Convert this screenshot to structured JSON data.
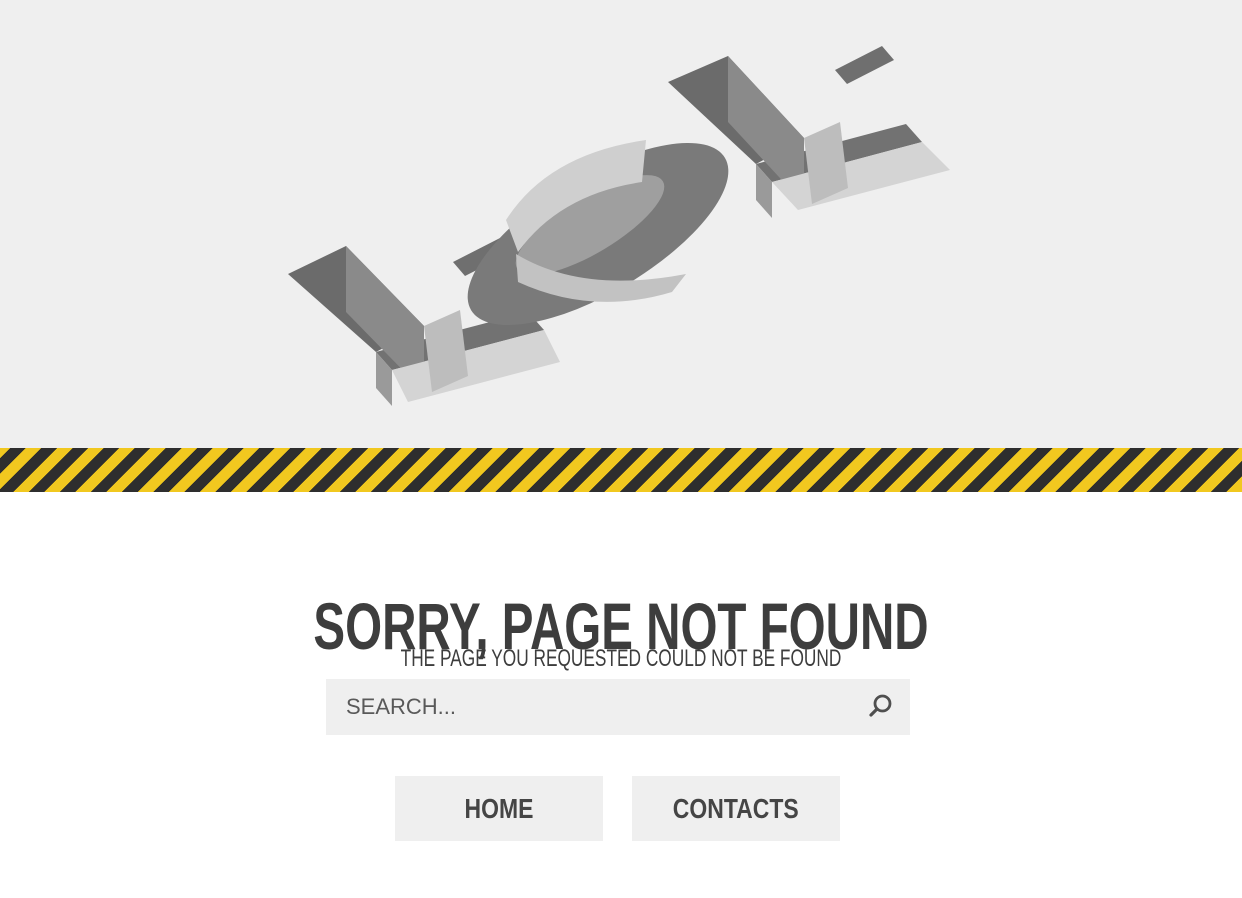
{
  "hero": {
    "error_code": "404"
  },
  "message": {
    "headline": "SORRY, PAGE NOT FOUND",
    "subline": "THE PAGE YOU REQUESTED COULD NOT BE FOUND"
  },
  "search": {
    "placeholder": "SEARCH...",
    "value": "",
    "icon": "search-icon"
  },
  "nav": {
    "home_label": "HOME",
    "contacts_label": "CONTACTS"
  },
  "colors": {
    "hero_background": "#efefef",
    "stripe_yellow": "#f1c81f",
    "stripe_dark": "#2e2e2e",
    "text_dark": "#3d3d3d",
    "button_background": "#efefef"
  }
}
